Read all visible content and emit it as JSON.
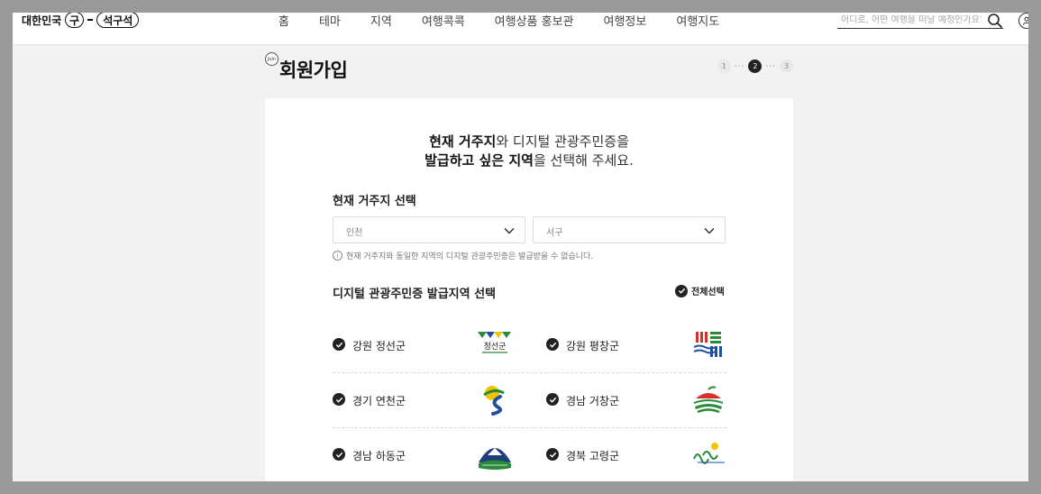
{
  "header": {
    "logo": {
      "prefix": "대한민국",
      "ring1": "구",
      "ring2": "석구석"
    },
    "nav": [
      "홈",
      "테마",
      "지역",
      "여행콕콕",
      "여행상품 홍보관",
      "여행정보",
      "여행지도"
    ],
    "search": {
      "placeholder": "어디로, 어떤 여행을 떠날 예정인가요?",
      "icon": "search-icon"
    },
    "user_icon": "user-icon"
  },
  "page": {
    "badge": "Join",
    "title": "회원가입",
    "steps": [
      "1",
      "2",
      "3"
    ],
    "active_step": 2
  },
  "card": {
    "lead": {
      "line1_bold": "현재 거주지",
      "line1_rest": "와 디지털 관광주민증을",
      "line2_bold": "발급하고 싶은 지역",
      "line2_rest": "을 선택해 주세요."
    },
    "residence": {
      "label": "현재 거주지 선택",
      "select1": "인천",
      "select2": "서구",
      "notice": "현재 거주지와 동일한 지역의 디지털 관광주민증은 발급받을 수 없습니다."
    },
    "issue": {
      "label": "디지털 관광주민증 발급지역 선택",
      "select_all": "전체선택",
      "regions": [
        {
          "name": "강원 정선군",
          "emblem_text": "정선군"
        },
        {
          "name": "강원 평창군"
        },
        {
          "name": "경기 연천군"
        },
        {
          "name": "경남 거창군"
        },
        {
          "name": "경남 하동군"
        },
        {
          "name": "경북 고령군"
        }
      ]
    }
  },
  "colors": {
    "accent": "#222222",
    "background": "#f2f2f2",
    "emblem_green": "#2a8a3a",
    "emblem_blue": "#1f4fa0",
    "emblem_yellow": "#f2c400",
    "emblem_red": "#d6312b"
  }
}
